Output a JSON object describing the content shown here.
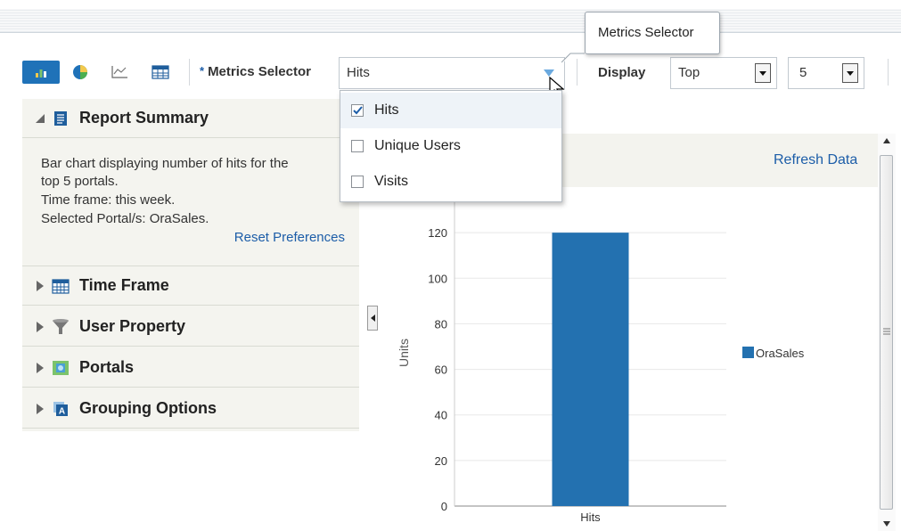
{
  "toolbar": {
    "metrics_label": "Metrics Selector",
    "required_mark": "*",
    "metrics_value": "Hits",
    "display_label": "Display",
    "display_value": "Top",
    "count_value": "5",
    "icons": [
      "bar-chart-icon",
      "pie-chart-icon",
      "line-chart-icon",
      "table-icon"
    ]
  },
  "tooltip": {
    "text": "Metrics Selector"
  },
  "dropdown": {
    "options": [
      {
        "label": "Hits",
        "checked": true
      },
      {
        "label": "Unique Users",
        "checked": false
      },
      {
        "label": "Visits",
        "checked": false
      }
    ]
  },
  "left_panel": {
    "summary": {
      "title": "Report Summary",
      "lines": [
        "Bar chart displaying number of hits for the",
        "top 5 portals.",
        "Time frame: this week.",
        "Selected Portal/s: OraSales."
      ],
      "reset_link": "Reset Preferences"
    },
    "sections": [
      {
        "title": "Time Frame",
        "icon": "calendar-icon"
      },
      {
        "title": "User Property",
        "icon": "filter-icon"
      },
      {
        "title": "Portals",
        "icon": "portal-icon"
      },
      {
        "title": "Grouping Options",
        "icon": "grouping-icon"
      }
    ]
  },
  "chart_header": {
    "refresh_link": "Refresh Data"
  },
  "colors": {
    "accent": "#1f72b8",
    "bar": "#2371b0",
    "link": "#1c5da8"
  },
  "chart_data": {
    "type": "bar",
    "categories": [
      "Hits"
    ],
    "series": [
      {
        "name": "OraSales",
        "values": [
          120
        ]
      }
    ],
    "xlabel": "",
    "ylabel": "Units",
    "ylim": [
      0,
      140
    ],
    "yticks": [
      0,
      20,
      40,
      60,
      80,
      100,
      120
    ],
    "legend_position": "right",
    "grid": true
  }
}
